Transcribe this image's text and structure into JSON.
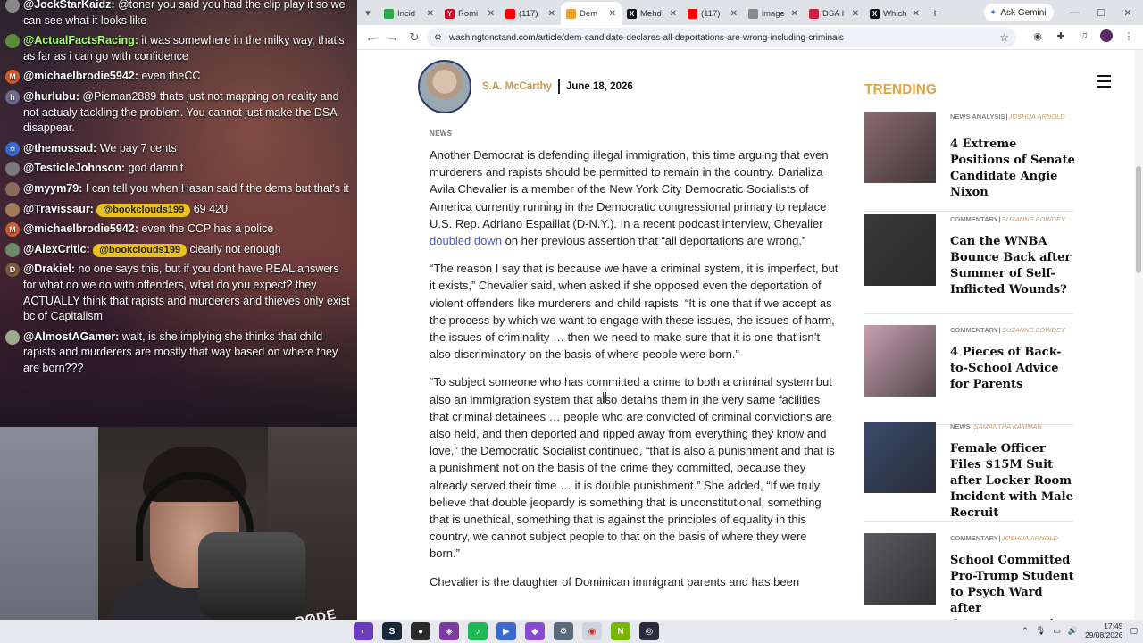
{
  "chat": [
    {
      "user": "@JockStarKaidz:",
      "text": "@toner you said you had the clip play it so we can see what it looks like",
      "badge_color": "#888888",
      "badge": "",
      "cls": "m-white"
    },
    {
      "user": "@ActualFactsRacing:",
      "text": "it was somewhere in the milky way, that's as far as i can go with confidence",
      "badge_color": "#5b8a3a",
      "badge": "",
      "cls": "m-green"
    },
    {
      "user": "@michaelbrodie5942:",
      "text": "even theCC",
      "badge_color": "#d25a2a",
      "badge": "M",
      "cls": "m-white"
    },
    {
      "user": "@hurlubu:",
      "text": "@Pieman2889 thats just not mapping on reality and not actualy tackling the problem. You cannot just make the DSA disappear.",
      "badge_color": "#6a6a8a",
      "badge": "h",
      "cls": "m-white"
    },
    {
      "user": "@themossad:",
      "text": "We pay 7 cents",
      "badge_color": "#3a6ad0",
      "badge": "✡",
      "cls": "m-white"
    },
    {
      "user": "@TesticleJohnson:",
      "text": "god damnit",
      "badge_color": "#7a7a7a",
      "badge": "",
      "cls": "m-white"
    },
    {
      "user": "@myym79:",
      "text": "I can tell you when Hasan said f the dems but that's it",
      "badge_color": "#8a6a5a",
      "badge": "",
      "cls": "m-white"
    },
    {
      "user": "@Travissaur:",
      "text": "69 420",
      "pill": "@bookclouds199",
      "badge_color": "#a07a5a",
      "badge": "",
      "cls": "m-white"
    },
    {
      "user": "@michaelbrodie5942:",
      "text": "even the CCP has a police",
      "badge_color": "#d25a2a",
      "badge": "M",
      "cls": "m-white"
    },
    {
      "user": "@AlexCritic:",
      "text": "clearly not enough",
      "pill": "@bookclouds199",
      "badge_color": "#6a8a6a",
      "badge": "",
      "cls": "m-white"
    },
    {
      "user": "@Drakiel:",
      "text": "no one says this, but if you dont have REAL answers for what do we do with offenders, what do you expect? they ACTUALLY think that rapists and murderers and thieves only exist bc of Capitalism",
      "badge_color": "#7a5a3a",
      "badge": "D",
      "cls": "m-white"
    },
    {
      "user": "@AlmostAGamer:",
      "text": "wait, is she implying she thinks that child rapists and murderers are mostly that way based on where they are born???",
      "badge_color": "#9aaa8a",
      "badge": "",
      "cls": "m-white"
    }
  ],
  "webcam_mic_label": "RØDE",
  "tabs": [
    {
      "label": "Incid",
      "fav_color": "#2aa84a"
    },
    {
      "label": "Romi",
      "fav_color": "#c8102e",
      "fav": "Y"
    },
    {
      "label": "(117)",
      "fav_color": "#ff0000"
    },
    {
      "label": "Dem",
      "fav_color": "#f0a030",
      "active": true
    },
    {
      "label": "Mehd",
      "fav_color": "#111111",
      "fav": "X"
    },
    {
      "label": "(117)",
      "fav_color": "#ff0000"
    },
    {
      "label": "image",
      "fav_color": "#888888"
    },
    {
      "label": "DSA I",
      "fav_color": "#d02040"
    },
    {
      "label": "Which",
      "fav_color": "#111111",
      "fav": "X"
    }
  ],
  "gemini_label": "Ask Gemini",
  "url": "washingtonstand.com/article/dem-candidate-declares-all-deportations-are-wrong-including-criminals",
  "author": {
    "name": "S.A. McCarthy",
    "date": "June 18, 2026"
  },
  "kicker": "NEWS",
  "article": {
    "p1_before": "Another Democrat is defending illegal immigration, this time arguing that even murderers and rapists should be permitted to remain in the country. Darializa Avila Chevalier is a member of the New York City Democratic Socialists of America currently running in the Democratic congressional primary to replace U.S. Rep. Adriano Espaillat (D-N.Y.). In a recent podcast interview, Chevalier ",
    "p1_link": "doubled down",
    "p1_after": " on her previous assertion that “all deportations are wrong.”",
    "p2": "“The reason I say that is because we have a criminal system, it is imperfect, but it exists,” Chevalier said, when asked if she opposed even the deportation of violent offenders like murderers and child rapists. “It is one that if we accept as the process by which we want to engage with these issues, the issues of harm, the issues of criminality … then we need to make sure that it is one that isn’t also discriminatory on the basis of where people were born.”",
    "p3": "“To subject someone who has committed a crime to both a criminal system but also an immigration system that also detains them in the very same facilities that criminal detainees … people who are convicted of criminal convictions are also held, and then deported and ripped away from everything they know and love,” the Democratic Socialist continued, “that is also a punishment and that is a punishment not on the basis of the crime they committed, because they already served their time … it is double punishment.” She added, “If we truly believe that double jeopardy is something that is unconstitutional, something that is unethical, something that is against the principles of equality in this country, we cannot subject people to that on the basis of where they were born.”",
    "p4": "Chevalier is the daughter of Dominican immigrant parents and has been"
  },
  "trending": {
    "title": "TRENDING",
    "items": [
      {
        "cat": "NEWS ANALYSIS",
        "author": "JOSHUA ARNOLD",
        "title": "4 Extreme Positions of Senate Candidate Angie Nixon",
        "thumb": "#8a6a70"
      },
      {
        "cat": "COMMENTARY",
        "author": "SUZANNE BOWDEY",
        "title": "Can the WNBA Bounce Back after Summer of Self-Inflicted Wounds?",
        "thumb": "#3a3a3a"
      },
      {
        "cat": "COMMENTARY",
        "author": "SUZANNE BOWDEY",
        "title": "4 Pieces of Back-to-School Advice for Parents",
        "thumb": "#c8a0b0"
      },
      {
        "cat": "NEWS",
        "author": "SAMANTHA KAMMAN",
        "title": "Female Officer Files $15M Suit after Locker Room Incident with Male Recruit",
        "thumb": "#3a4a6a"
      },
      {
        "cat": "COMMENTARY",
        "author": "JOSHUA ARNOLD",
        "title": "School Committed Pro-Trump Student to Psych Ward after Counterprotesting Anti-ICE Protest:",
        "thumb": "#5a5a60"
      }
    ]
  },
  "clock": {
    "time": "17:45",
    "date": "29/08/2026"
  }
}
